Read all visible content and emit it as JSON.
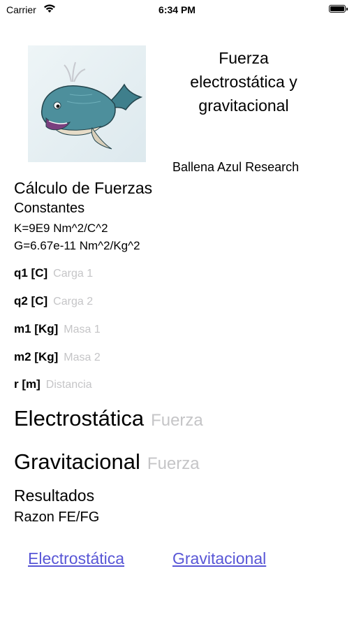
{
  "status_bar": {
    "carrier": "Carrier",
    "time": "6:34 PM"
  },
  "header": {
    "title_lines": [
      "Fuerza",
      "electrostática y",
      "gravitacional"
    ],
    "company": "Ballena Azul Research"
  },
  "section": {
    "title": "Cálculo de Fuerzas",
    "constants_title": "Constantes",
    "k": "K=9E9 Nm^2/C^2",
    "g": "G=6.67e-11 Nm^2/Kg^2"
  },
  "inputs": [
    {
      "label": "q1 [C]",
      "placeholder": "Carga 1"
    },
    {
      "label": "q2 [C]",
      "placeholder": "Carga 2"
    },
    {
      "label": "m1 [Kg]",
      "placeholder": "Masa 1"
    },
    {
      "label": "m2 [Kg]",
      "placeholder": "Masa 2"
    },
    {
      "label": "r [m]",
      "placeholder": "Distancia"
    }
  ],
  "forces": [
    {
      "label": "Electrostática",
      "placeholder": "Fuerza"
    },
    {
      "label": "Gravitacional",
      "placeholder": "Fuerza"
    }
  ],
  "results": {
    "title": "Resultados",
    "ratio_label": "Razon FE/FG"
  },
  "links": {
    "electro": "Electrostática",
    "gravit": "Gravitacional"
  },
  "colors": {
    "link": "#5856d6",
    "placeholder": "#c5c5c7"
  }
}
